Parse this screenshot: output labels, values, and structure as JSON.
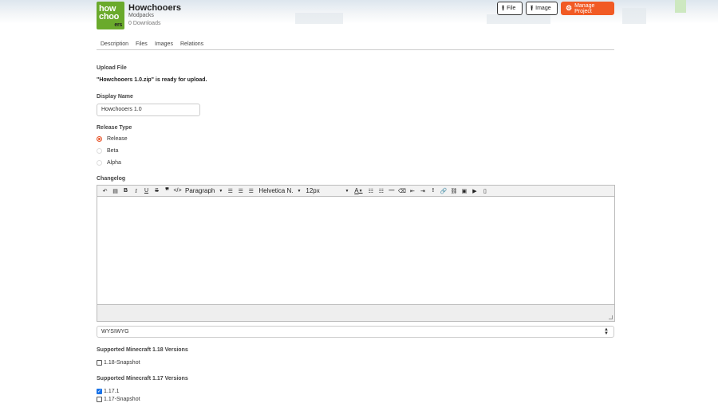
{
  "header": {
    "logo_text": [
      "how",
      "choo",
      "ers"
    ],
    "project_name": "Howchooers",
    "category": "Modpacks",
    "downloads": "0 Downloads",
    "buttons": {
      "file": "File",
      "image": "Image",
      "manage": "Manage Project"
    },
    "accent_color": "#f15a24"
  },
  "tabs": [
    "Description",
    "Files",
    "Images",
    "Relations"
  ],
  "form": {
    "upload_label": "Upload File",
    "upload_status": "\"Howchooers 1.0.zip\" is ready for upload.",
    "display_name_label": "Display Name",
    "display_name_value": "Howchooers 1.0",
    "release_type_label": "Release Type",
    "release_types": [
      {
        "label": "Release",
        "selected": true
      },
      {
        "label": "Beta",
        "selected": false
      },
      {
        "label": "Alpha",
        "selected": false
      }
    ],
    "changelog_label": "Changelog",
    "editor": {
      "block_format": "Paragraph",
      "font_family": "Helvetica N.",
      "font_size": "12px"
    },
    "markup_type": "WYSIWYG",
    "versions_118_label": "Supported Minecraft 1.18 Versions",
    "versions_118": [
      {
        "label": "1.18-Snapshot",
        "checked": false
      }
    ],
    "versions_117_label": "Supported Minecraft 1.17 Versions",
    "versions_117": [
      {
        "label": "1.17.1",
        "checked": true
      },
      {
        "label": "1.17-Snapshot",
        "checked": false
      }
    ]
  }
}
